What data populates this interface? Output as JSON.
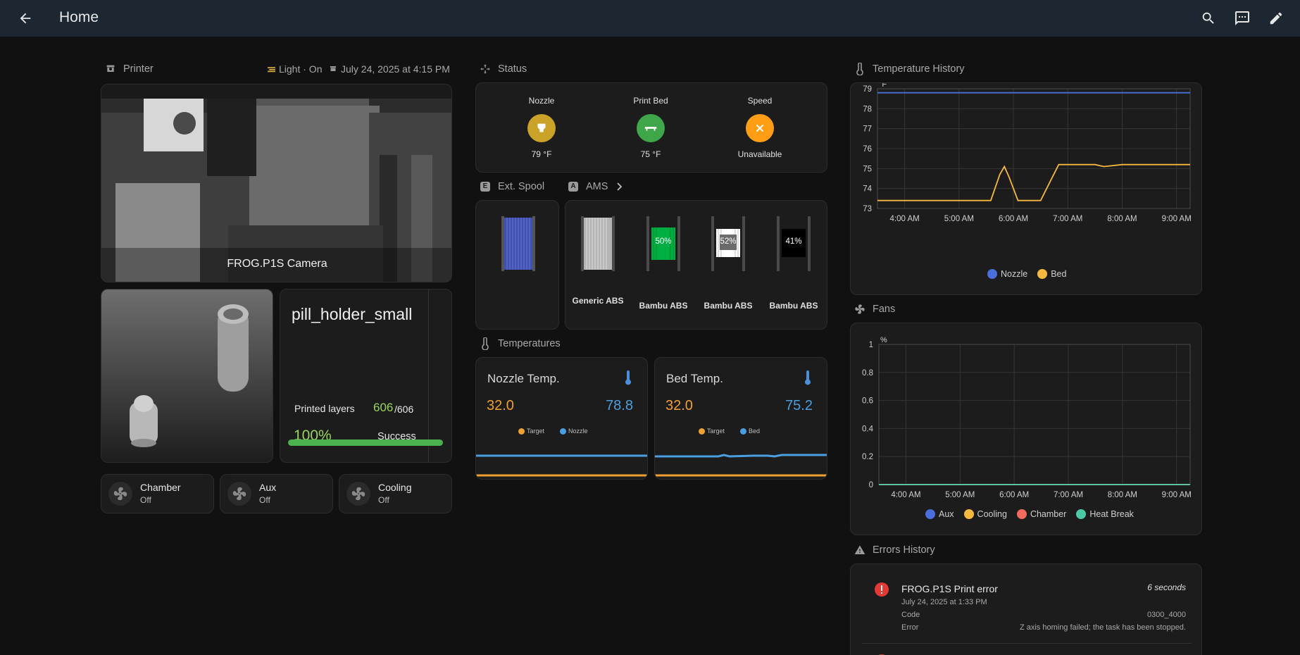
{
  "header": {
    "title": "Home"
  },
  "printer": {
    "section_title": "Printer",
    "light_status": "Light · On",
    "timestamp": "July 24, 2025 at 4:15 PM",
    "camera_label": "FROG.P1S Camera",
    "job_name": "pill_holder_small",
    "layers_label": "Printed layers",
    "layers_done": "606",
    "layers_total": "/606",
    "progress_pct": "100%",
    "progress_value": 100,
    "job_state": "Success"
  },
  "fans_controls": [
    {
      "name": "Chamber",
      "state": "Off"
    },
    {
      "name": "Aux",
      "state": "Off"
    },
    {
      "name": "Cooling",
      "state": "Off"
    }
  ],
  "status": {
    "section_title": "Status",
    "items": [
      {
        "label": "Nozzle",
        "value": "79 °F",
        "color": "#c9a227"
      },
      {
        "label": "Print Bed",
        "value": "75 °F",
        "color": "#3fa64a"
      },
      {
        "label": "Speed",
        "value": "Unavailable",
        "color": "#ff9e15"
      }
    ]
  },
  "ext_spool": {
    "section_title": "Ext. Spool",
    "badge": "E"
  },
  "ams": {
    "section_title": "AMS",
    "badge": "A",
    "slots": [
      {
        "name": "Generic ABS",
        "percent": "",
        "color": "#b5b5b5"
      },
      {
        "name": "Bambu ABS",
        "percent": "50%",
        "color": "#00ae42"
      },
      {
        "name": "Bambu ABS",
        "percent": "52%",
        "color": "#ffffff"
      },
      {
        "name": "Bambu ABS",
        "percent": "41%",
        "color": "#000000"
      }
    ]
  },
  "temperatures": {
    "section_title": "Temperatures",
    "nozzle": {
      "title": "Nozzle Temp.",
      "target": "32.0",
      "current": "78.8",
      "legend_target": "Target",
      "legend_current": "Nozzle"
    },
    "bed": {
      "title": "Bed Temp.",
      "target": "32.0",
      "current": "75.2",
      "legend_target": "Target",
      "legend_current": "Bed"
    }
  },
  "temp_history": {
    "section_title": "Temperature History",
    "unit": "°F",
    "y_ticks": [
      "79",
      "78",
      "77",
      "76",
      "75",
      "74",
      "73"
    ],
    "x_ticks": [
      "4:00 AM",
      "5:00 AM",
      "6:00 AM",
      "7:00 AM",
      "8:00 AM",
      "9:00 AM"
    ],
    "legend": [
      {
        "name": "Nozzle",
        "color": "#4a6fdc"
      },
      {
        "name": "Bed",
        "color": "#f5b940"
      }
    ]
  },
  "fans_history": {
    "section_title": "Fans",
    "unit": "%",
    "y_ticks": [
      "1",
      "0.8",
      "0.6",
      "0.4",
      "0.2",
      "0"
    ],
    "x_ticks": [
      "4:00 AM",
      "5:00 AM",
      "6:00 AM",
      "7:00 AM",
      "8:00 AM",
      "9:00 AM"
    ],
    "legend": [
      {
        "name": "Aux",
        "color": "#4a6fdc"
      },
      {
        "name": "Cooling",
        "color": "#f5b940"
      },
      {
        "name": "Chamber",
        "color": "#f06a5e"
      },
      {
        "name": "Heat Break",
        "color": "#4cc9a6"
      }
    ]
  },
  "errors": {
    "section_title": "Errors History",
    "item": {
      "title": "FROG.P1S Print error",
      "age": "6 seconds",
      "date": "July 24, 2025 at 1:33 PM",
      "code_label": "Code",
      "code": "0300_4000",
      "error_label": "Error",
      "error": "Z axis homing failed; the task has been stopped."
    }
  },
  "chart_data": [
    {
      "type": "line",
      "title": "Temperature History",
      "ylabel": "°F",
      "ylim": [
        73,
        79
      ],
      "x": [
        "3:30 AM",
        "4:00 AM",
        "5:00 AM",
        "5:35 AM",
        "5:45 AM",
        "5:50 AM",
        "5:55 AM",
        "6:05 AM",
        "6:30 AM",
        "6:40 AM",
        "6:50 AM",
        "7:30 AM",
        "7:40 AM",
        "8:00 AM",
        "9:00 AM",
        "9:15 AM"
      ],
      "series": [
        {
          "name": "Nozzle",
          "values": [
            78.8,
            78.8,
            78.8,
            78.8,
            78.8,
            78.8,
            78.8,
            78.8,
            78.8,
            78.8,
            78.8,
            78.8,
            78.8,
            78.8,
            78.8,
            78.8
          ]
        },
        {
          "name": "Bed",
          "values": [
            73.4,
            73.4,
            73.4,
            73.4,
            74.7,
            75.1,
            74.6,
            73.4,
            73.4,
            74.3,
            75.2,
            75.2,
            75.1,
            75.2,
            75.2,
            75.2
          ]
        }
      ],
      "grid": true,
      "legend": "bottom"
    },
    {
      "type": "line",
      "title": "Fans",
      "ylabel": "%",
      "ylim": [
        0,
        1
      ],
      "x": [
        "3:30 AM",
        "9:15 AM"
      ],
      "series": [
        {
          "name": "Aux",
          "values": [
            0,
            0
          ]
        },
        {
          "name": "Cooling",
          "values": [
            0,
            0
          ]
        },
        {
          "name": "Chamber",
          "values": [
            0,
            0
          ]
        },
        {
          "name": "Heat Break",
          "values": [
            0,
            0
          ]
        }
      ],
      "grid": true,
      "legend": "bottom"
    }
  ]
}
